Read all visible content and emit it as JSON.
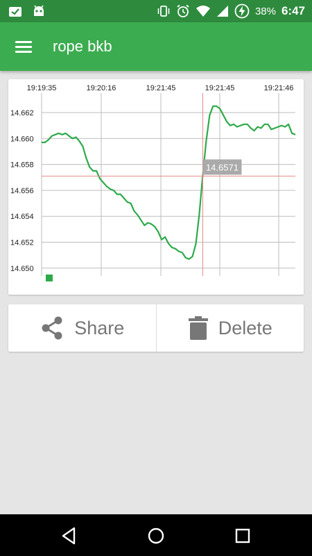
{
  "status_bar": {
    "time": "6:47",
    "battery_percent": "38%",
    "icons_left": [
      "clipboard-check-icon",
      "android-debug-icon"
    ],
    "icons_right": [
      "vibrate-icon",
      "alarm-icon",
      "wifi-icon",
      "signal-icon",
      "battery-charging-icon"
    ]
  },
  "app_bar": {
    "title": "rope bkb",
    "menu_icon": "hamburger-menu-icon"
  },
  "chart_data": {
    "type": "line",
    "x_tick_labels": [
      "19:19:35",
      "19:20:16",
      "19:21:45",
      "19:21:45",
      "19:21:46"
    ],
    "y_tick_labels": [
      "14.662",
      "14.660",
      "14.658",
      "14.656",
      "14.654",
      "14.652",
      "14.650"
    ],
    "ylim": [
      14.6494,
      14.6635
    ],
    "grid": true,
    "x_axis_position": "top",
    "series": [
      {
        "color": "#2eaa4a",
        "values": [
          14.6597,
          14.6597,
          14.6599,
          14.6602,
          14.6603,
          14.6604,
          14.6603,
          14.6604,
          14.6602,
          14.66,
          14.6601,
          14.6598,
          14.6594,
          14.6585,
          14.6578,
          14.6575,
          14.6575,
          14.6569,
          14.6566,
          14.6563,
          14.6561,
          14.656,
          14.6557,
          14.6557,
          14.6554,
          14.6551,
          14.655,
          14.6544,
          14.6541,
          14.6537,
          14.6533,
          14.6535,
          14.6534,
          14.6532,
          14.6528,
          14.6522,
          14.6524,
          14.6519,
          14.6516,
          14.6515,
          14.6513,
          14.6512,
          14.6508,
          14.6507,
          14.6509,
          14.6519,
          14.6542,
          14.6572,
          14.6598,
          14.6618,
          14.6625,
          14.6625,
          14.6623,
          14.6618,
          14.6613,
          14.661,
          14.6611,
          14.6609,
          14.661,
          14.6611,
          14.6611,
          14.6608,
          14.6606,
          14.6609,
          14.6608,
          14.6611,
          14.6611,
          14.6607,
          14.6608,
          14.6609,
          14.661,
          14.6609,
          14.6611,
          14.6604,
          14.6603
        ]
      }
    ],
    "highlight": {
      "value": 14.6571,
      "label": "14.6571",
      "index": 47,
      "line_color": "#e88a8a",
      "label_bg": "#aaaaaa"
    },
    "legend": {
      "position": "bottom-left",
      "color": "#2eaa4a"
    }
  },
  "actions": {
    "share_label": "Share",
    "share_icon": "share-icon",
    "delete_label": "Delete",
    "delete_icon": "trash-icon"
  },
  "nav_bar": {
    "icons": [
      "back-icon",
      "home-icon",
      "recents-icon"
    ]
  },
  "colors": {
    "status_bar": "#2e8b3e",
    "app_bar": "#3cac50",
    "line": "#2eaa4a",
    "background": "#e5e5e5"
  }
}
